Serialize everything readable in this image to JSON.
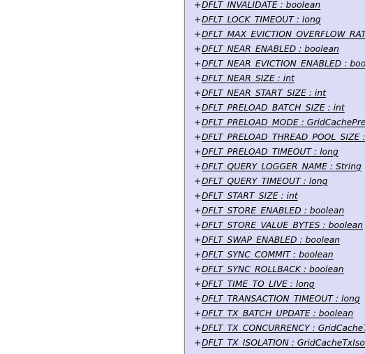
{
  "class_box": {
    "visibility_symbol": "+",
    "attributes": [
      "DFLT_INVALIDATE : boolean",
      "DFLT_LOCK_TIMEOUT : long",
      "DFLT_MAX_EVICTION_OVERFLOW_RATIO",
      "DFLT_NEAR_ENABLED : boolean",
      "DFLT_NEAR_EVICTION_ENABLED : bool",
      "DFLT_NEAR_SIZE : int",
      "DFLT_NEAR_START_SIZE : int",
      "DFLT_PRELOAD_BATCH_SIZE : int",
      "DFLT_PRELOAD_MODE : GridCachePrelo",
      "DFLT_PRELOAD_THREAD_POOL_SIZE : in",
      "DFLT_PRELOAD_TIMEOUT : long",
      "DFLT_QUERY_LOGGER_NAME : String",
      "DFLT_QUERY_TIMEOUT : long",
      "DFLT_START_SIZE : int",
      "DFLT_STORE_ENABLED : boolean",
      "DFLT_STORE_VALUE_BYTES : boolean",
      "DFLT_SWAP_ENABLED : boolean",
      "DFLT_SYNC_COMMIT : boolean",
      "DFLT_SYNC_ROLLBACK : boolean",
      "DFLT_TIME_TO_LIVE : long",
      "DFLT_TRANSACTION_TIMEOUT : long",
      "DFLT_TX_BATCH_UPDATE : boolean",
      "DFLT_TX_CONCURRENCY : GridCacheTx",
      "DFLT_TX_ISOLATION : GridCacheTxIsola"
    ]
  },
  "colors": {
    "box_fill": "#dcdcf6",
    "box_border": "#8c8c8c",
    "text": "#000000"
  }
}
